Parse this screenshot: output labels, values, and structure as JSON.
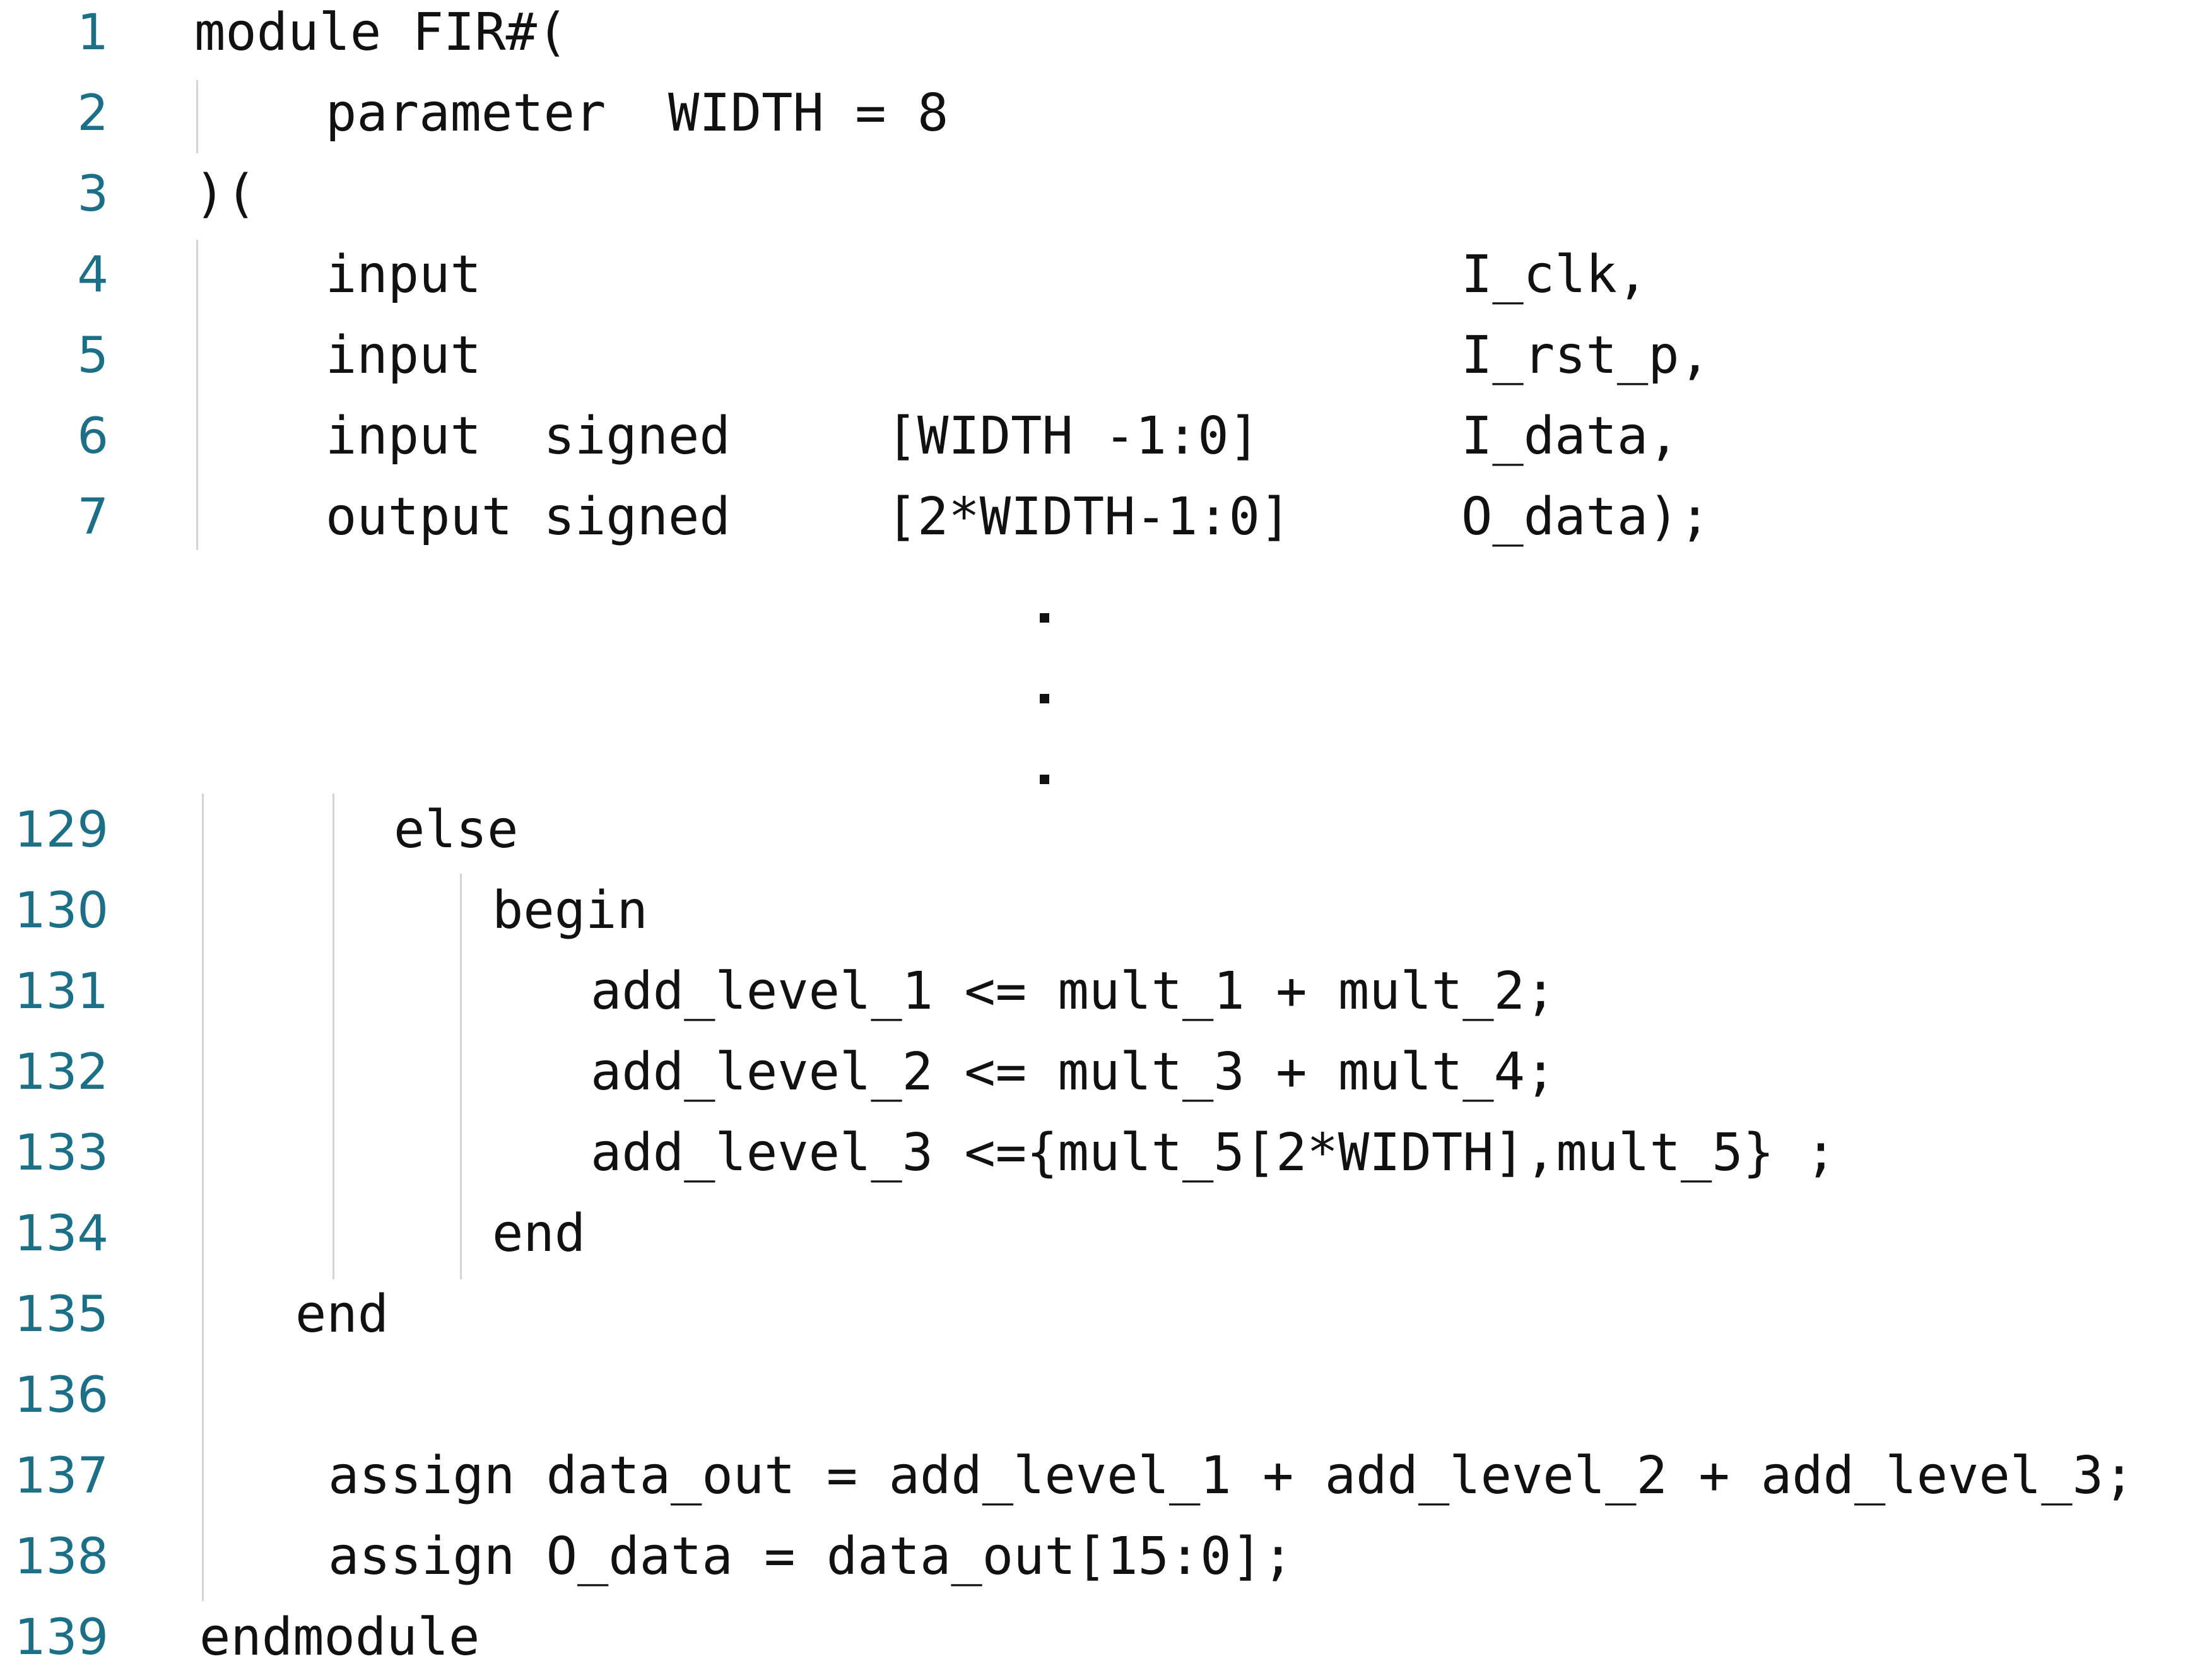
{
  "editor": {
    "lines": [
      {
        "number": "1",
        "text": "module FIR#("
      },
      {
        "number": "2",
        "text": "parameter  WIDTH = 8"
      },
      {
        "number": "3",
        "text": ")("
      },
      {
        "number": "4",
        "code": "input",
        "name": "I_clk,"
      },
      {
        "number": "5",
        "code": "input",
        "name": "I_rst_p,"
      },
      {
        "number": "6",
        "code": "input  signed     [WIDTH -1:0]",
        "name": "I_data,"
      },
      {
        "number": "7",
        "code": "output signed     [2*WIDTH-1:0]",
        "name": "O_data);"
      },
      {
        "number": "129",
        "text": "else"
      },
      {
        "number": "130",
        "text": "begin"
      },
      {
        "number": "131",
        "text": "add_level_1 <= mult_1 + mult_2;"
      },
      {
        "number": "132",
        "text": "add_level_2 <= mult_3 + mult_4;"
      },
      {
        "number": "133",
        "text": "add_level_3 <={mult_5[2*WIDTH],mult_5} ;"
      },
      {
        "number": "134",
        "text": "end"
      },
      {
        "number": "135",
        "text": "end"
      },
      {
        "number": "136",
        "text": ""
      },
      {
        "number": "137",
        "text": "assign data_out = add_level_1 + add_level_2 + add_level_3;"
      },
      {
        "number": "138",
        "text": "assign O_data = data_out[15:0];"
      },
      {
        "number": "139",
        "text": "endmodule"
      }
    ]
  }
}
